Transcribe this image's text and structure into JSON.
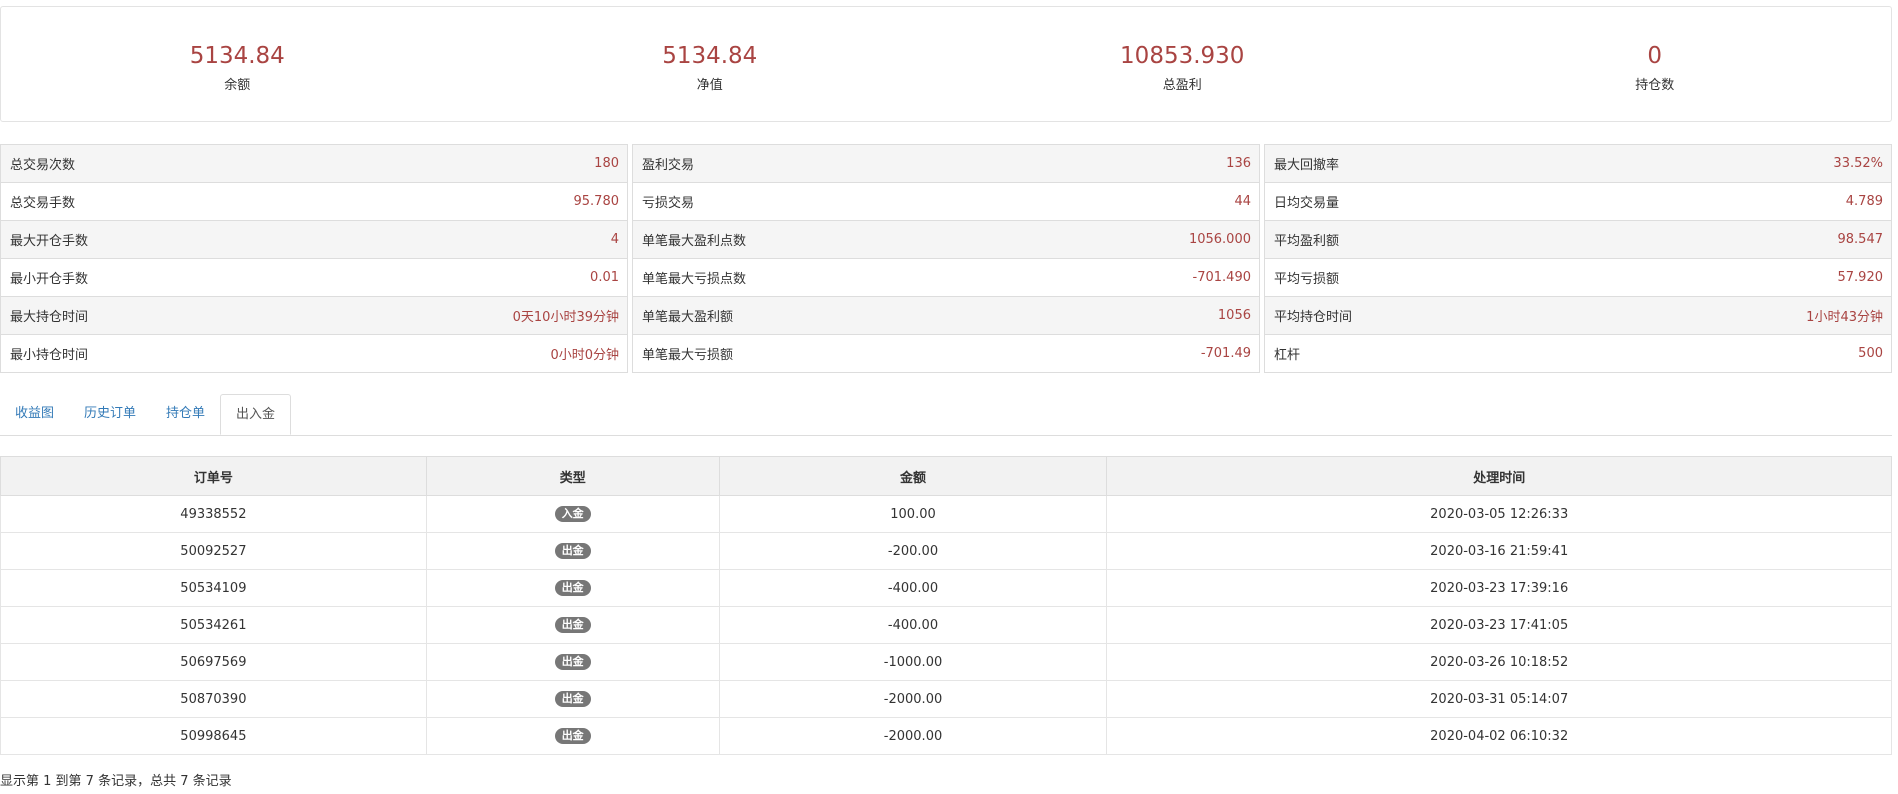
{
  "summary": [
    {
      "value": "5134.84",
      "label": "余额"
    },
    {
      "value": "5134.84",
      "label": "净值"
    },
    {
      "value": "10853.930",
      "label": "总盈利"
    },
    {
      "value": "0",
      "label": "持仓数"
    }
  ],
  "stats": [
    [
      {
        "label": "总交易次数",
        "value": "180"
      },
      {
        "label": "总交易手数",
        "value": "95.780"
      },
      {
        "label": "最大开仓手数",
        "value": "4"
      },
      {
        "label": "最小开仓手数",
        "value": "0.01"
      },
      {
        "label": "最大持仓时间",
        "value": "0天10小时39分钟"
      },
      {
        "label": "最小持仓时间",
        "value": "0小时0分钟"
      }
    ],
    [
      {
        "label": "盈利交易",
        "value": "136"
      },
      {
        "label": "亏损交易",
        "value": "44"
      },
      {
        "label": "单笔最大盈利点数",
        "value": "1056.000"
      },
      {
        "label": "单笔最大亏损点数",
        "value": "-701.490"
      },
      {
        "label": "单笔最大盈利额",
        "value": "1056"
      },
      {
        "label": "单笔最大亏损额",
        "value": "-701.49"
      }
    ],
    [
      {
        "label": "最大回撤率",
        "value": "33.52%"
      },
      {
        "label": "日均交易量",
        "value": "4.789"
      },
      {
        "label": "平均盈利额",
        "value": "98.547"
      },
      {
        "label": "平均亏损额",
        "value": "57.920"
      },
      {
        "label": "平均持仓时间",
        "value": "1小时43分钟"
      },
      {
        "label": "杠杆",
        "value": "500"
      }
    ]
  ],
  "tabs": [
    {
      "label": "收益图",
      "active": false
    },
    {
      "label": "历史订单",
      "active": false
    },
    {
      "label": "持仓单",
      "active": false
    },
    {
      "label": "出入金",
      "active": true
    }
  ],
  "table": {
    "headers": [
      "订单号",
      "类型",
      "金额",
      "处理时间"
    ],
    "rows": [
      {
        "order": "49338552",
        "type": "入金",
        "amount": "100.00",
        "time": "2020-03-05 12:26:33"
      },
      {
        "order": "50092527",
        "type": "出金",
        "amount": "-200.00",
        "time": "2020-03-16 21:59:41"
      },
      {
        "order": "50534109",
        "type": "出金",
        "amount": "-400.00",
        "time": "2020-03-23 17:39:16"
      },
      {
        "order": "50534261",
        "type": "出金",
        "amount": "-400.00",
        "time": "2020-03-23 17:41:05"
      },
      {
        "order": "50697569",
        "type": "出金",
        "amount": "-1000.00",
        "time": "2020-03-26 10:18:52"
      },
      {
        "order": "50870390",
        "type": "出金",
        "amount": "-2000.00",
        "time": "2020-03-31 05:14:07"
      },
      {
        "order": "50998645",
        "type": "出金",
        "amount": "-2000.00",
        "time": "2020-04-02 06:10:32"
      }
    ]
  },
  "pagination": {
    "text": "显示第 1 到第 7 条记录，总共 7 条记录"
  },
  "colors": {
    "value_red": "#a94442",
    "link_blue": "#337ab7",
    "badge_gray": "#777777"
  }
}
